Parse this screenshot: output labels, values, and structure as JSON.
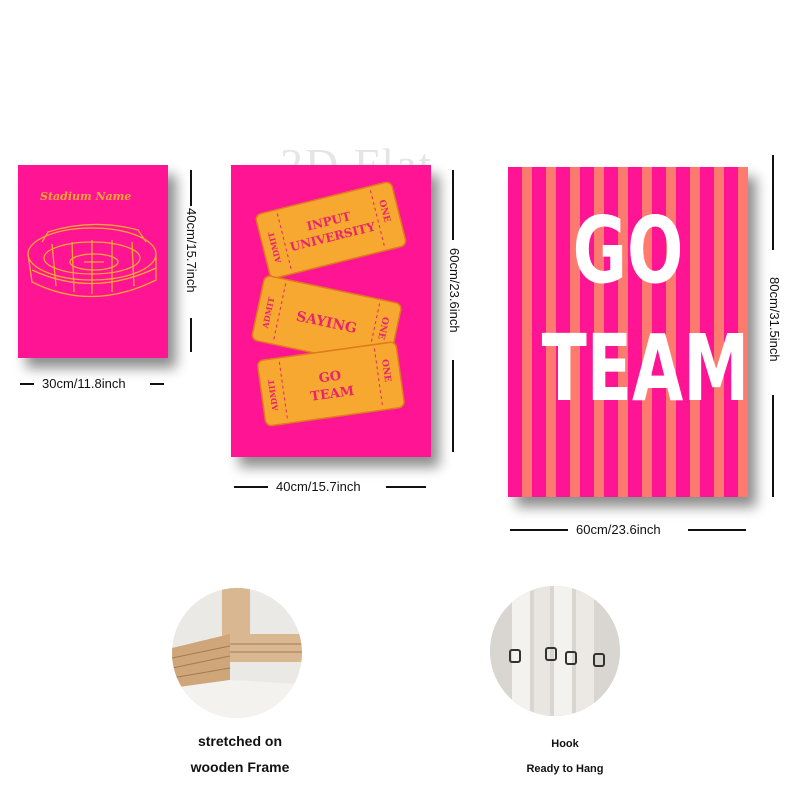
{
  "watermark": "2D Flat",
  "posters": [
    {
      "id": "stadium",
      "title": "Stadium Name",
      "width_label": "30cm/11.8inch",
      "height_label": "40cm/15.7inch"
    },
    {
      "id": "tickets",
      "tickets": [
        {
          "side_left": "ADMIT",
          "main": [
            "INPUT",
            "UNIVERSITY"
          ],
          "side_right": "ONE"
        },
        {
          "side_left": "ADMIT",
          "main": [
            "SAYING"
          ],
          "side_right": "ONE"
        },
        {
          "side_left": "ADMIT",
          "main": [
            "GO",
            "TEAM"
          ],
          "side_right": "ONE"
        }
      ],
      "width_label": "40cm/15.7inch",
      "height_label": "60cm/23.6inch"
    },
    {
      "id": "goteam",
      "line1": "GO",
      "line2": "TEAM",
      "width_label": "60cm/23.6inch",
      "height_label": "80cm/31.5inch"
    }
  ],
  "features": [
    {
      "caption_line1": "stretched on",
      "caption_line2": "wooden Frame"
    },
    {
      "caption_line1": "Hook",
      "caption_line2": "Ready to Hang"
    }
  ],
  "colors": {
    "pink": "#ff1493",
    "orange": "#f7a830",
    "stripe": "#ff7a6e"
  }
}
